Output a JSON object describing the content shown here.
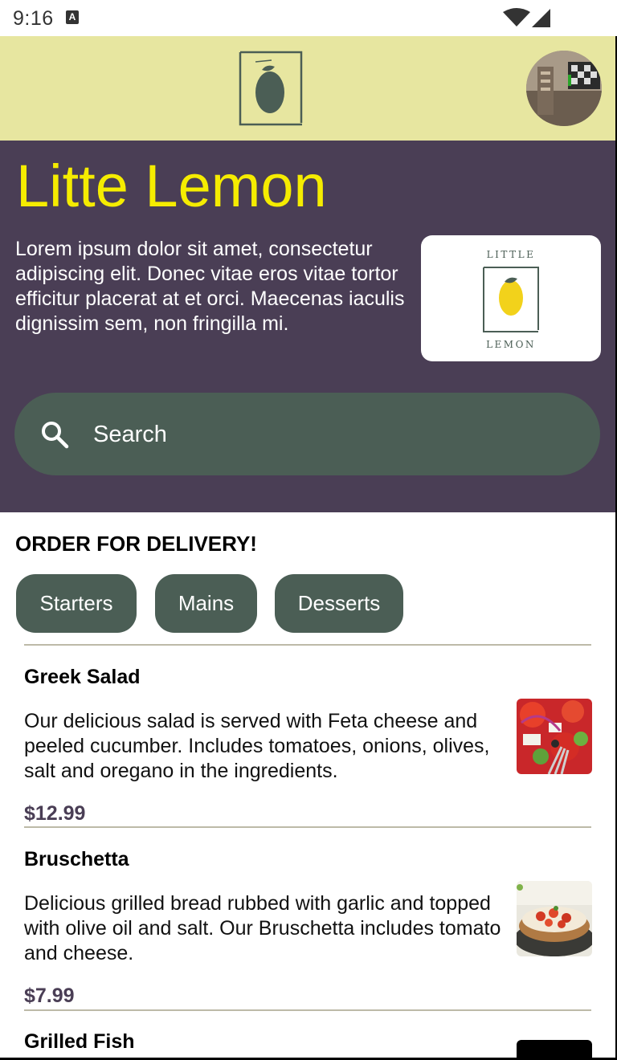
{
  "status_bar": {
    "time": "9:16",
    "notification_icon": "A",
    "icons": [
      "notification-icon",
      "wifi-icon",
      "cell-signal-icon"
    ]
  },
  "header": {
    "logo_icon": "lemon-logo-icon",
    "avatar": "profile-avatar"
  },
  "hero": {
    "title": "Litte Lemon",
    "description": "Lorem ipsum dolor sit amet, consectetur adipiscing elit. Donec vitae eros vitae tortor efficitur placerat at et orci. Maecenas iaculis dignissim sem, non fringilla mi.",
    "card_logo_top": "LITTLE",
    "card_logo_bottom": "LEMON",
    "search_placeholder": "Search"
  },
  "menu": {
    "section_title": "ORDER FOR DELIVERY!",
    "categories": [
      "Starters",
      "Mains",
      "Desserts"
    ],
    "dishes": [
      {
        "name": "Greek Salad",
        "description": "Our delicious salad is served with Feta cheese and peeled cucumber. Includes tomatoes, onions, olives, salt and oregano in the ingredients.",
        "price": "$12.99"
      },
      {
        "name": "Bruschetta",
        "description": "Delicious grilled bread rubbed with garlic and topped with olive oil and salt. Our Bruschetta includes tomato and cheese.",
        "price": "$7.99"
      },
      {
        "name": "Grilled Fish",
        "description": "",
        "price": ""
      }
    ]
  },
  "colors": {
    "header_bg": "#e7e6a0",
    "hero_bg": "#4a3e55",
    "title_yellow": "#f5ec00",
    "chip_green": "#4b5e55",
    "price_purple": "#4a3e55"
  }
}
